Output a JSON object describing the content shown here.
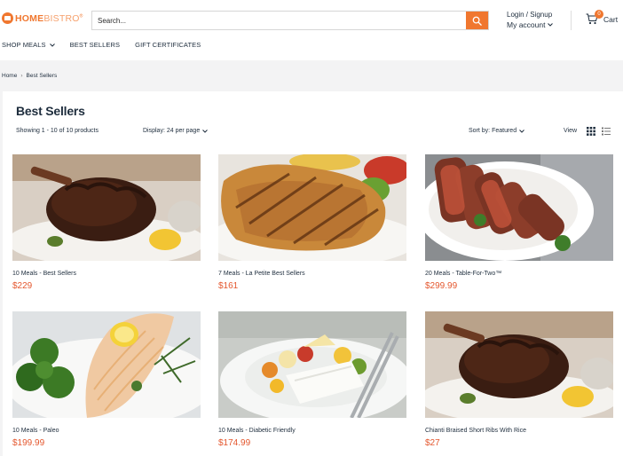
{
  "header": {
    "logo_home": "HOME",
    "logo_bistro": "BISTRO",
    "logo_mark": "®",
    "search_placeholder": "Search...",
    "account_login": "Login / Signup",
    "account_label": "My account",
    "cart_label": "Cart",
    "cart_count": "0"
  },
  "nav": {
    "items": [
      {
        "label": "SHOP MEALS"
      },
      {
        "label": "BEST SELLERS"
      },
      {
        "label": "GIFT CERTIFICATES"
      }
    ]
  },
  "breadcrumb": {
    "home": "Home",
    "separator": "›",
    "current": "Best Sellers"
  },
  "collection": {
    "title": "Best Sellers",
    "count_text": "Showing 1 - 10 of 10 products",
    "display_text": "Display: 24 per page",
    "sort_text": "Sort by: Featured",
    "view_label": "View"
  },
  "products": [
    {
      "name": "10 Meals - Best Sellers",
      "price": "$229",
      "image": "short-ribs"
    },
    {
      "name": "7 Meals - La Petite Best Sellers",
      "price": "$161",
      "image": "grilled-chicken"
    },
    {
      "name": "20 Meals - Table-For-Two™",
      "price": "$299.99",
      "image": "sliced-steak"
    },
    {
      "name": "10 Meals - Paleo",
      "price": "$199.99",
      "image": "salmon-broccoli"
    },
    {
      "name": "10 Meals - Diabetic Friendly",
      "price": "$174.99",
      "image": "fish-vegetables"
    },
    {
      "name": "Chianti Braised Short Ribs With Rice",
      "price": "$27",
      "image": "short-ribs"
    }
  ],
  "colors": {
    "accent": "#f0772f",
    "price": "#e4572e",
    "text": "#1e2d3d",
    "band": "#f3f3f4"
  }
}
